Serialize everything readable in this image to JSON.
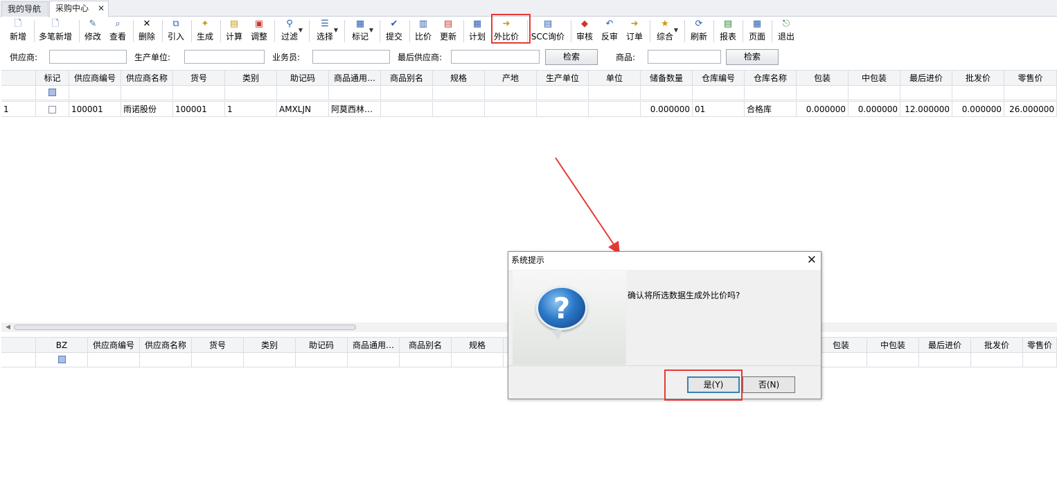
{
  "tabs": [
    {
      "label": "我的导航"
    },
    {
      "label": "采购中心",
      "close": "✕"
    }
  ],
  "toolbar": {
    "buttons": [
      {
        "label": "新增",
        "icon": "new-document-icon",
        "glyph": "🗋"
      },
      {
        "label": "多笔新增",
        "icon": "multi-new-icon",
        "glyph": "🗋"
      },
      {
        "label": "修改",
        "icon": "edit-icon",
        "glyph": "✎"
      },
      {
        "label": "查看",
        "icon": "view-icon",
        "glyph": "⌕"
      },
      {
        "label": "删除",
        "icon": "delete-icon",
        "glyph": "✕"
      },
      {
        "label": "引入",
        "icon": "import-icon",
        "glyph": "⧉"
      },
      {
        "label": "生成",
        "icon": "generate-icon",
        "glyph": "✦"
      },
      {
        "label": "计算",
        "icon": "calculate-icon",
        "glyph": "▤"
      },
      {
        "label": "调整",
        "icon": "adjust-icon",
        "glyph": "▣"
      },
      {
        "label": "过滤",
        "icon": "filter-binoculars-icon",
        "glyph": "⚲"
      },
      {
        "label": "选择",
        "icon": "select-icon",
        "glyph": "☰"
      },
      {
        "label": "标记",
        "icon": "mark-icon",
        "glyph": "▦"
      },
      {
        "label": "提交",
        "icon": "submit-check-icon",
        "glyph": "✔"
      },
      {
        "label": "比价",
        "icon": "compare-price-icon",
        "glyph": "▥"
      },
      {
        "label": "更新",
        "icon": "update-icon",
        "glyph": "▤"
      },
      {
        "label": "计划",
        "icon": "plan-icon",
        "glyph": "▦"
      },
      {
        "label": "外比价",
        "icon": "external-compare-icon",
        "glyph": "➜"
      },
      {
        "label": "SCC询价",
        "icon": "scc-inquiry-icon",
        "glyph": "▤"
      },
      {
        "label": "审核",
        "icon": "approve-icon",
        "glyph": "◆"
      },
      {
        "label": "反审",
        "icon": "unapprove-icon",
        "glyph": "↶"
      },
      {
        "label": "订单",
        "icon": "order-icon",
        "glyph": "➜"
      },
      {
        "label": "综合",
        "icon": "composite-icon",
        "glyph": "★"
      },
      {
        "label": "刷新",
        "icon": "refresh-icon",
        "glyph": "⟳"
      },
      {
        "label": "报表",
        "icon": "report-icon",
        "glyph": "▤"
      },
      {
        "label": "页面",
        "icon": "page-icon",
        "glyph": "▦"
      },
      {
        "label": "退出",
        "icon": "exit-door-icon",
        "glyph": "⎋"
      }
    ]
  },
  "search": {
    "supplier_label": "供应商:",
    "manufacturer_label": "生产单位:",
    "salesman_label": "业务员:",
    "last_supplier_label": "最后供应商:",
    "search_btn": "检索",
    "product_label": "商品:",
    "search_btn2": "检索"
  },
  "top_grid": {
    "headers": [
      "标记",
      "供应商编号",
      "供应商名称",
      "货号",
      "类别",
      "助记码",
      "商品通用…",
      "商品别名",
      "规格",
      "产地",
      "生产单位",
      "单位",
      "储备数量",
      "仓库编号",
      "仓库名称",
      "包装",
      "中包装",
      "最后进价",
      "批发价",
      "零售价"
    ],
    "rows": [
      [
        "1",
        "",
        "100001",
        "雨诺股份",
        "100001",
        "1",
        "AMXLJN",
        "阿莫西林…",
        "",
        "",
        "",
        "",
        "",
        "0.000000",
        "01",
        "合格库",
        "0.000000",
        "0.000000",
        "12.000000",
        "0.000000",
        "26.000000"
      ]
    ]
  },
  "bottom_grid": {
    "headers": [
      "BZ",
      "供应商编号",
      "供应商名称",
      "货号",
      "类别",
      "助记码",
      "商品通用…",
      "商品别名",
      "规格",
      "包装",
      "中包装",
      "最后进价",
      "批发价",
      "零售价"
    ]
  },
  "dialog": {
    "title": "系统提示",
    "message": "确认将所选数据生成外比价吗?",
    "yes": "是(Y)",
    "no": "否(N)",
    "close": "✕",
    "icon": "question-icon",
    "glyph": "?"
  },
  "colors": {
    "highlight": "#e53935",
    "annotation_arrow": "#e53935"
  }
}
